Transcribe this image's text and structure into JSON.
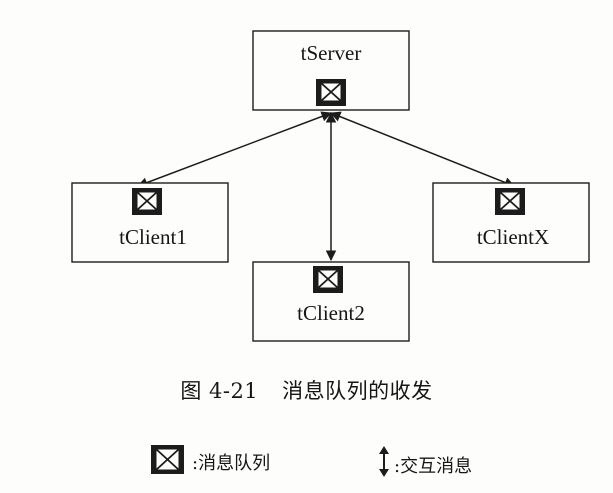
{
  "nodes": {
    "server": {
      "label": "tServer"
    },
    "client1": {
      "label": "tClient1"
    },
    "client2": {
      "label": "tClient2"
    },
    "clientX": {
      "label": "tClientX"
    }
  },
  "caption": {
    "figure_number": "图 4-21",
    "title": "消息队列的收发"
  },
  "legend": {
    "queue_label": ":消息队列",
    "message_label": ":交互消息"
  },
  "icons": {
    "queue": "message-queue-icon",
    "message": "double-arrow-icon"
  },
  "colors": {
    "ink": "#1c1c1c",
    "paper": "#fdfdfb"
  }
}
